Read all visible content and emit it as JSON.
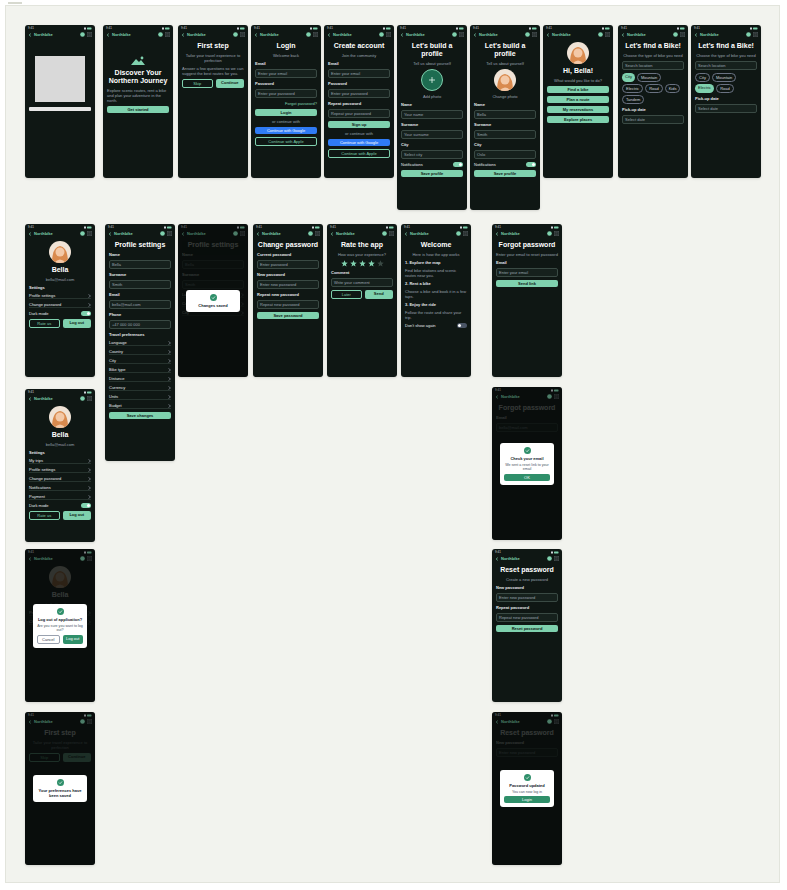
{
  "app": {
    "brand": "Northbike",
    "time": "9:41"
  },
  "screens": [
    {
      "dimmed": false,
      "elements": [
        {
          "kind": "image"
        },
        {
          "kind": "bar"
        }
      ]
    },
    {
      "dimmed": false,
      "elements": [
        {
          "kind": "logo"
        },
        {
          "kind": "title",
          "text": "Discover Your Northern Journey"
        },
        {
          "kind": "text",
          "text": "Explore scenic routes, rent a bike and plan your adventure in the north."
        },
        {
          "kind": "button",
          "text": "Get started"
        }
      ]
    },
    {
      "dimmed": false,
      "elements": [
        {
          "kind": "title",
          "text": "First step"
        },
        {
          "kind": "subtitle",
          "text": "Tailor your travel experience to perfection"
        },
        {
          "kind": "text",
          "text": "Answer a few questions so we can suggest the best routes for you."
        },
        {
          "kind": "row",
          "items": [
            {
              "kind": "button-outline",
              "text": "Skip"
            },
            {
              "kind": "button",
              "text": "Continue"
            }
          ]
        }
      ]
    },
    {
      "dimmed": false,
      "elements": [
        {
          "kind": "title",
          "text": "Login"
        },
        {
          "kind": "subtitle",
          "text": "Welcome back"
        },
        {
          "kind": "label",
          "text": "Email"
        },
        {
          "kind": "field",
          "text": "Enter your email"
        },
        {
          "kind": "label",
          "text": "Password"
        },
        {
          "kind": "field",
          "text": "Enter your password"
        },
        {
          "kind": "link",
          "text": "Forgot password?"
        },
        {
          "kind": "button",
          "text": "Login"
        },
        {
          "kind": "subtitle",
          "text": "or continue with"
        },
        {
          "kind": "button-blue",
          "text": "Continue with Google"
        },
        {
          "kind": "button-outline",
          "text": "Continue with Apple"
        }
      ]
    },
    {
      "dimmed": false,
      "elements": [
        {
          "kind": "title",
          "text": "Create account"
        },
        {
          "kind": "subtitle",
          "text": "Join the community"
        },
        {
          "kind": "label",
          "text": "Email"
        },
        {
          "kind": "field",
          "text": "Enter your email"
        },
        {
          "kind": "label",
          "text": "Password"
        },
        {
          "kind": "field",
          "text": "Enter your password"
        },
        {
          "kind": "label",
          "text": "Repeat password"
        },
        {
          "kind": "field",
          "text": "Repeat your password"
        },
        {
          "kind": "button",
          "text": "Sign up"
        },
        {
          "kind": "subtitle",
          "text": "or continue with"
        },
        {
          "kind": "button-blue",
          "text": "Continue with Google"
        },
        {
          "kind": "button-outline",
          "text": "Continue with Apple"
        }
      ]
    },
    {
      "dimmed": false,
      "elements": [
        {
          "kind": "title",
          "text": "Let's build a profile"
        },
        {
          "kind": "subtitle",
          "text": "Tell us about yourself"
        },
        {
          "kind": "avatar",
          "photo": false
        },
        {
          "kind": "subtitle",
          "text": "Add photo"
        },
        {
          "kind": "label",
          "text": "Name"
        },
        {
          "kind": "field",
          "text": "Your name"
        },
        {
          "kind": "label",
          "text": "Surname"
        },
        {
          "kind": "field",
          "text": "Your surname"
        },
        {
          "kind": "label",
          "text": "City"
        },
        {
          "kind": "field",
          "text": "Select city"
        },
        {
          "kind": "toggle",
          "text": "Notifications",
          "on": true
        },
        {
          "kind": "button",
          "text": "Save profile"
        }
      ]
    },
    {
      "dimmed": false,
      "elements": [
        {
          "kind": "title",
          "text": "Let's build a profile"
        },
        {
          "kind": "subtitle",
          "text": "Tell us about yourself"
        },
        {
          "kind": "avatar",
          "photo": true
        },
        {
          "kind": "subtitle",
          "text": "Change photo"
        },
        {
          "kind": "label",
          "text": "Name"
        },
        {
          "kind": "field",
          "text": "Bella"
        },
        {
          "kind": "label",
          "text": "Surname"
        },
        {
          "kind": "field",
          "text": "Smith"
        },
        {
          "kind": "label",
          "text": "City"
        },
        {
          "kind": "field",
          "text": "Oslo"
        },
        {
          "kind": "toggle",
          "text": "Notifications",
          "on": true
        },
        {
          "kind": "button",
          "text": "Save profile"
        }
      ]
    },
    {
      "dimmed": false,
      "elements": [
        {
          "kind": "avatar",
          "photo": true
        },
        {
          "kind": "title",
          "text": "Hi, Bella!"
        },
        {
          "kind": "subtitle",
          "text": "What would you like to do?"
        },
        {
          "kind": "button",
          "text": "Find a bike"
        },
        {
          "kind": "button",
          "text": "Plan a route"
        },
        {
          "kind": "button",
          "text": "My reservations"
        },
        {
          "kind": "button",
          "text": "Explore places"
        }
      ]
    },
    {
      "dimmed": false,
      "elements": [
        {
          "kind": "title",
          "text": "Let's find a Bike!"
        },
        {
          "kind": "subtitle",
          "text": "Choose the type of bike you need"
        },
        {
          "kind": "field",
          "text": "Search location"
        },
        {
          "kind": "chips",
          "items": [
            {
              "text": "City",
              "selected": true
            },
            {
              "text": "Mountain",
              "selected": false
            },
            {
              "text": "Electric",
              "selected": false
            },
            {
              "text": "Road",
              "selected": false
            },
            {
              "text": "Kids",
              "selected": false
            },
            {
              "text": "Tandem",
              "selected": false
            }
          ]
        },
        {
          "kind": "label",
          "text": "Pick-up date"
        },
        {
          "kind": "field",
          "text": "Select date"
        }
      ]
    },
    {
      "dimmed": false,
      "elements": [
        {
          "kind": "title",
          "text": "Let's find a Bike!"
        },
        {
          "kind": "subtitle",
          "text": "Choose the type of bike you need"
        },
        {
          "kind": "field",
          "text": "Search location"
        },
        {
          "kind": "chips",
          "items": [
            {
              "text": "City",
              "selected": false
            },
            {
              "text": "Mountain",
              "selected": false
            },
            {
              "text": "Electric",
              "selected": true
            },
            {
              "text": "Road",
              "selected": false
            }
          ]
        },
        {
          "kind": "label",
          "text": "Pick-up date"
        },
        {
          "kind": "field",
          "text": "Select date"
        }
      ]
    },
    {
      "dimmed": false,
      "elements": [
        {
          "kind": "avatar",
          "photo": true
        },
        {
          "kind": "title",
          "text": "Bella"
        },
        {
          "kind": "subtitle",
          "text": "bella@mail.com"
        },
        {
          "kind": "label",
          "text": "Settings"
        },
        {
          "kind": "menu-item",
          "text": "Profile settings"
        },
        {
          "kind": "menu-item",
          "text": "Change password"
        },
        {
          "kind": "toggle",
          "text": "Dark mode",
          "on": true
        },
        {
          "kind": "row",
          "items": [
            {
              "kind": "button-outline",
              "text": "Rate us"
            },
            {
              "kind": "button",
              "text": "Log out"
            }
          ]
        }
      ]
    },
    {
      "dimmed": false,
      "elements": [
        {
          "kind": "title",
          "text": "Profile settings"
        },
        {
          "kind": "label",
          "text": "Name"
        },
        {
          "kind": "field",
          "text": "Bella"
        },
        {
          "kind": "label",
          "text": "Surname"
        },
        {
          "kind": "field",
          "text": "Smith"
        },
        {
          "kind": "label",
          "text": "Email"
        },
        {
          "kind": "field",
          "text": "bella@mail.com"
        },
        {
          "kind": "label",
          "text": "Phone"
        },
        {
          "kind": "field",
          "text": "+47 000 00 000"
        },
        {
          "kind": "label",
          "text": "Travel preferences"
        },
        {
          "kind": "menu-item",
          "text": "Language"
        },
        {
          "kind": "menu-item",
          "text": "Country"
        },
        {
          "kind": "menu-item",
          "text": "City"
        },
        {
          "kind": "menu-item",
          "text": "Bike type"
        },
        {
          "kind": "menu-item",
          "text": "Distance"
        },
        {
          "kind": "menu-item",
          "text": "Currency"
        },
        {
          "kind": "menu-item",
          "text": "Units"
        },
        {
          "kind": "menu-item",
          "text": "Budget"
        },
        {
          "kind": "button",
          "text": "Save changes"
        }
      ]
    },
    {
      "dimmed": true,
      "elements": [
        {
          "kind": "title",
          "text": "Profile settings"
        },
        {
          "kind": "label",
          "text": "Name"
        },
        {
          "kind": "field",
          "text": "Bella"
        },
        {
          "kind": "label",
          "text": "Surname"
        },
        {
          "kind": "field",
          "text": "Smith"
        },
        {
          "kind": "menu-item",
          "text": "Language"
        },
        {
          "kind": "menu-item",
          "text": "Country"
        },
        {
          "kind": "menu-item",
          "text": "City"
        }
      ],
      "modal": {
        "title": "Changes saved",
        "buttons": []
      }
    },
    {
      "dimmed": false,
      "elements": [
        {
          "kind": "title",
          "text": "Change password"
        },
        {
          "kind": "label",
          "text": "Current password"
        },
        {
          "kind": "field",
          "text": "Enter password"
        },
        {
          "kind": "label",
          "text": "New password"
        },
        {
          "kind": "field",
          "text": "Enter new password"
        },
        {
          "kind": "label",
          "text": "Repeat new password"
        },
        {
          "kind": "field",
          "text": "Repeat new password"
        },
        {
          "kind": "button",
          "text": "Save password"
        }
      ]
    },
    {
      "dimmed": false,
      "elements": [
        {
          "kind": "title",
          "text": "Rate the app"
        },
        {
          "kind": "subtitle",
          "text": "How was your experience?"
        },
        {
          "kind": "stars",
          "stars": 4
        },
        {
          "kind": "label",
          "text": "Comment"
        },
        {
          "kind": "field",
          "text": "Write your comment"
        },
        {
          "kind": "row",
          "items": [
            {
              "kind": "button-outline",
              "text": "Later"
            },
            {
              "kind": "button",
              "text": "Send"
            }
          ]
        }
      ]
    },
    {
      "dimmed": false,
      "elements": [
        {
          "kind": "title",
          "text": "Welcome"
        },
        {
          "kind": "subtitle",
          "text": "Here is how the app works"
        },
        {
          "kind": "label",
          "text": "1. Explore the map"
        },
        {
          "kind": "text",
          "text": "Find bike stations and scenic routes near you."
        },
        {
          "kind": "label",
          "text": "2. Rent a bike"
        },
        {
          "kind": "text",
          "text": "Choose a bike and book it in a few taps."
        },
        {
          "kind": "label",
          "text": "3. Enjoy the ride"
        },
        {
          "kind": "text",
          "text": "Follow the route and share your trip."
        },
        {
          "kind": "toggle",
          "text": "Don't show again",
          "on": false
        }
      ]
    },
    {
      "dimmed": false,
      "elements": [
        {
          "kind": "title",
          "text": "Forgot password"
        },
        {
          "kind": "subtitle",
          "text": "Enter your email to reset password"
        },
        {
          "kind": "label",
          "text": "Email"
        },
        {
          "kind": "field",
          "text": "Enter your email"
        },
        {
          "kind": "button",
          "text": "Send link"
        }
      ]
    },
    {
      "dimmed": false,
      "elements": [
        {
          "kind": "avatar",
          "photo": true
        },
        {
          "kind": "title",
          "text": "Bella"
        },
        {
          "kind": "subtitle",
          "text": "bella@mail.com"
        },
        {
          "kind": "label",
          "text": "Settings"
        },
        {
          "kind": "menu-item",
          "text": "My trips"
        },
        {
          "kind": "menu-item",
          "text": "Profile settings"
        },
        {
          "kind": "menu-item",
          "text": "Change password"
        },
        {
          "kind": "menu-item",
          "text": "Notifications"
        },
        {
          "kind": "menu-item",
          "text": "Payment"
        },
        {
          "kind": "toggle",
          "text": "Dark mode",
          "on": true
        },
        {
          "kind": "row",
          "items": [
            {
              "kind": "button-outline",
              "text": "Rate us"
            },
            {
              "kind": "button",
              "text": "Log out"
            }
          ]
        }
      ]
    },
    {
      "dimmed": true,
      "elements": [
        {
          "kind": "avatar",
          "photo": true
        },
        {
          "kind": "title",
          "text": "Bella"
        },
        {
          "kind": "subtitle",
          "text": "bella@mail.com"
        },
        {
          "kind": "menu-item",
          "text": "Profile settings"
        },
        {
          "kind": "menu-item",
          "text": "Change password"
        }
      ],
      "modal": {
        "title": "Log out of application?",
        "text": "Are you sure you want to log out?",
        "buttons": [
          "Cancel",
          "Log out"
        ]
      }
    },
    {
      "dimmed": true,
      "elements": [
        {
          "kind": "title",
          "text": "First step"
        },
        {
          "kind": "subtitle",
          "text": "Tailor your travel experience to perfection"
        },
        {
          "kind": "row",
          "items": [
            {
              "kind": "button-outline",
              "text": "Skip"
            },
            {
              "kind": "button",
              "text": "Continue"
            }
          ]
        }
      ],
      "modal": {
        "title": "Your preferences have been saved",
        "buttons": []
      }
    },
    {
      "dimmed": true,
      "elements": [
        {
          "kind": "title",
          "text": "Forgot password"
        },
        {
          "kind": "label",
          "text": "Email"
        },
        {
          "kind": "field",
          "text": "bella@mail.com"
        }
      ],
      "modal": {
        "title": "Check your email",
        "text": "We sent a reset link to your email",
        "buttons": [
          "OK"
        ]
      }
    },
    {
      "dimmed": false,
      "elements": [
        {
          "kind": "title",
          "text": "Reset password"
        },
        {
          "kind": "subtitle",
          "text": "Create a new password"
        },
        {
          "kind": "label",
          "text": "New password"
        },
        {
          "kind": "field",
          "text": "Enter new password"
        },
        {
          "kind": "label",
          "text": "Repeat password"
        },
        {
          "kind": "field",
          "text": "Repeat new password"
        },
        {
          "kind": "button",
          "text": "Reset password"
        }
      ]
    },
    {
      "dimmed": true,
      "elements": [
        {
          "kind": "title",
          "text": "Reset password"
        },
        {
          "kind": "label",
          "text": "New password"
        },
        {
          "kind": "field",
          "text": "Enter new password"
        }
      ],
      "modal": {
        "title": "Password updated",
        "text": "You can now log in",
        "buttons": [
          "Login"
        ]
      }
    }
  ]
}
